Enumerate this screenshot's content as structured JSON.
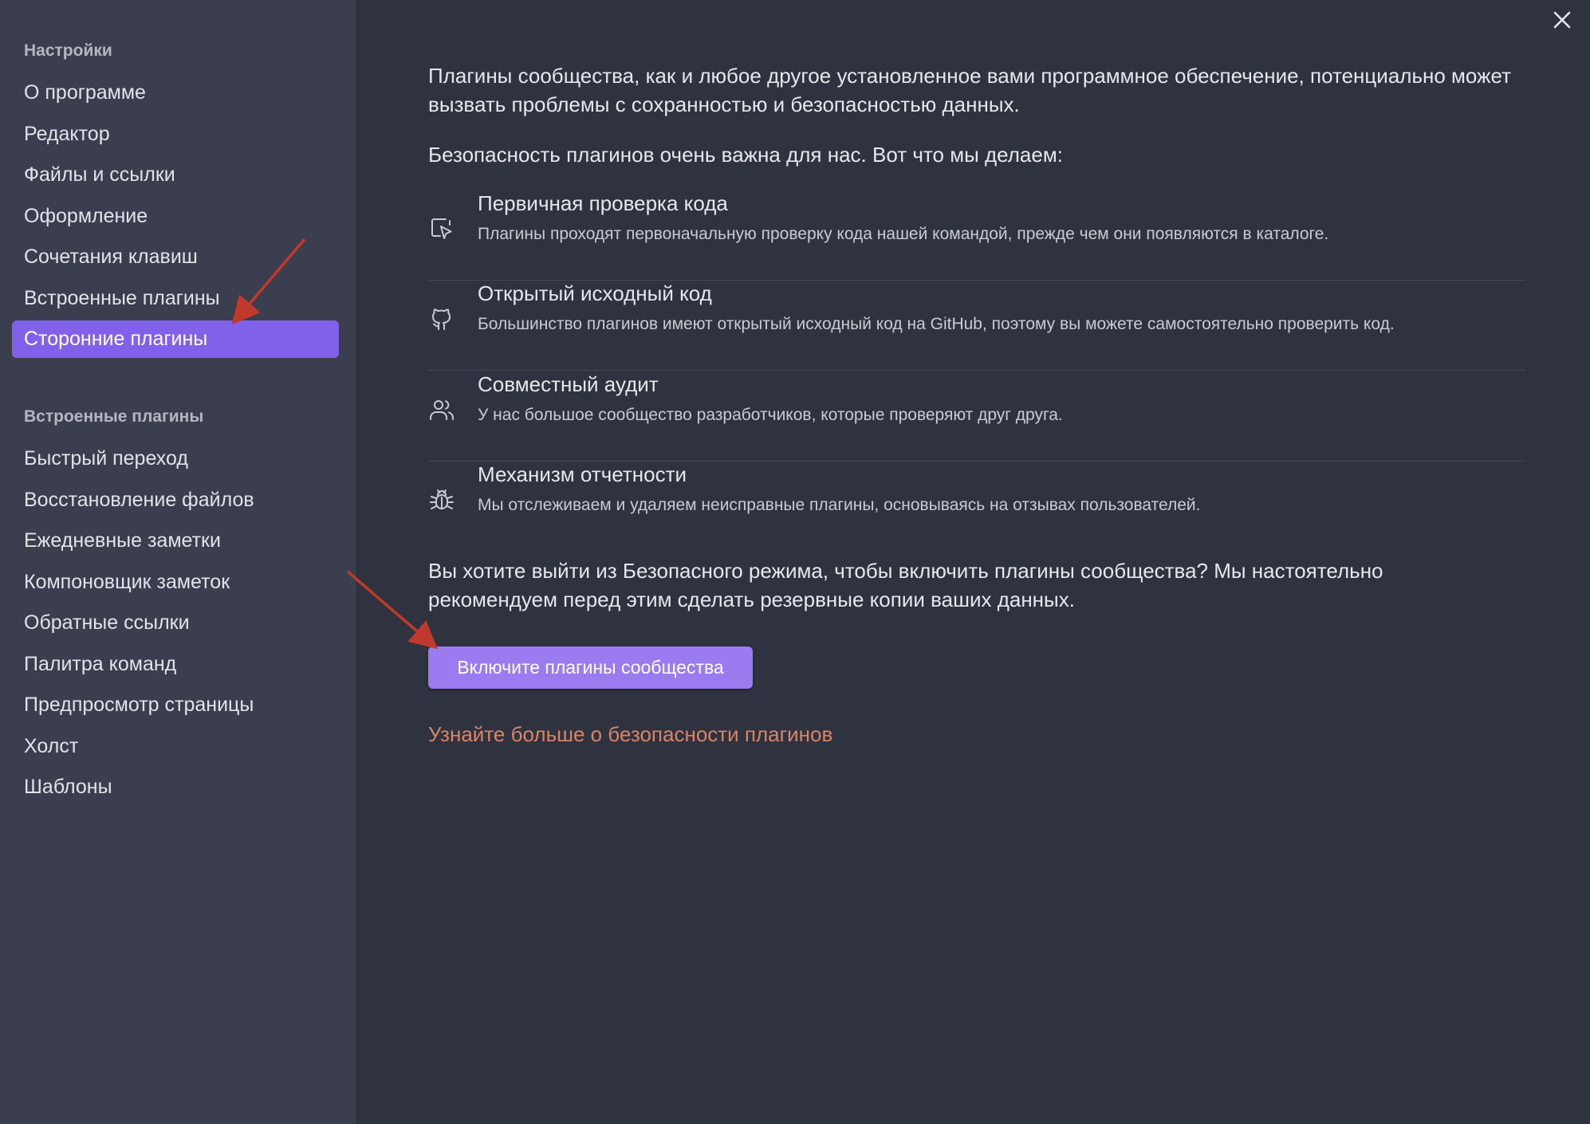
{
  "sidebar": {
    "settings_title": "Настройки",
    "settings_items": [
      {
        "label": "О программе"
      },
      {
        "label": "Редактор"
      },
      {
        "label": "Файлы и ссылки"
      },
      {
        "label": "Оформление"
      },
      {
        "label": "Сочетания клавиш"
      },
      {
        "label": "Встроенные плагины"
      },
      {
        "label": "Сторонние плагины",
        "active": true
      }
    ],
    "plugins_title": "Встроенные плагины",
    "plugin_items": [
      {
        "label": "Быстрый переход"
      },
      {
        "label": "Восстановление файлов"
      },
      {
        "label": "Ежедневные заметки"
      },
      {
        "label": "Компоновщик заметок"
      },
      {
        "label": "Обратные ссылки"
      },
      {
        "label": "Палитра команд"
      },
      {
        "label": "Предпросмотр страницы"
      },
      {
        "label": "Холст"
      },
      {
        "label": "Шаблоны"
      }
    ]
  },
  "main": {
    "intro": "Плагины сообщества, как и любое другое установленное вами программное обеспечение, потенциально может вызвать проблемы с сохранностью и безопасностью данных.",
    "safety_heading": "Безопасность плагинов очень важна для нас. Вот что мы делаем:",
    "features": [
      {
        "icon": "code-review-icon",
        "title": "Первичная проверка кода",
        "desc": "Плагины проходят первоначальную проверку кода нашей командой, прежде чем они появляются в каталоге."
      },
      {
        "icon": "github-icon",
        "title": "Открытый исходный код",
        "desc": "Большинство плагинов имеют открытый исходный код на GitHub, поэтому вы можете самостоятельно проверить код."
      },
      {
        "icon": "users-icon",
        "title": "Совместный аудит",
        "desc": "У нас большое сообщество разработчиков, которые проверяют друг друга."
      },
      {
        "icon": "bug-icon",
        "title": "Механизм отчетности",
        "desc": "Мы отслеживаем и удаляем неисправные плагины, основываясь на отзывах пользователей."
      }
    ],
    "question": "Вы хотите выйти из Безопасного режима, чтобы включить плагины сообщества? Мы настоятельно рекомендуем перед этим сделать резервные копии ваших данных.",
    "enable_button": "Включите плагины сообщества",
    "learn_more_link": "Узнайте больше о безопасности плагинов"
  },
  "colors": {
    "accent": "#8160ea",
    "button": "#9a7cf0",
    "link": "#d98467",
    "annotation_arrow": "#c0392b"
  }
}
